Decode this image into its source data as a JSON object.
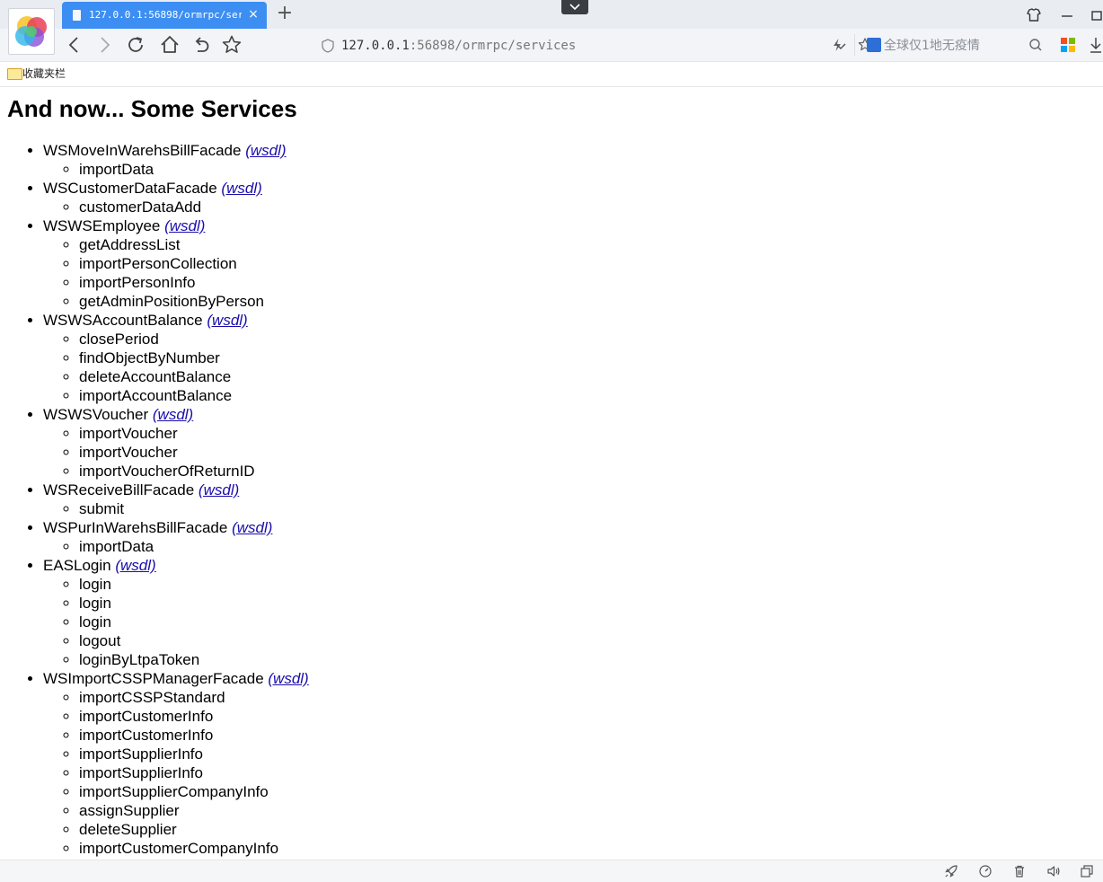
{
  "browser": {
    "tab_title": "127.0.0.1:56898/ormrpc/serv...",
    "tab_close": "×",
    "new_tab": "+",
    "url_host": "127.0.0.1",
    "url_rest": ":56898/ormrpc/services",
    "search_placeholder": "全球仅1地无疫情",
    "bookmarks_label": "收藏夹栏",
    "accent_color": "#3d8ef2"
  },
  "page": {
    "heading": "And now... Some Services",
    "wsdl_label": "(wsdl)",
    "services": [
      {
        "name": "WSMoveInWarehsBillFacade",
        "ops": [
          "importData"
        ]
      },
      {
        "name": "WSCustomerDataFacade",
        "ops": [
          "customerDataAdd"
        ]
      },
      {
        "name": "WSWSEmployee",
        "ops": [
          "getAddressList",
          "importPersonCollection",
          "importPersonInfo",
          "getAdminPositionByPerson"
        ]
      },
      {
        "name": "WSWSAccountBalance",
        "ops": [
          "closePeriod",
          "findObjectByNumber",
          "deleteAccountBalance",
          "importAccountBalance"
        ]
      },
      {
        "name": "WSWSVoucher",
        "ops": [
          "importVoucher",
          "importVoucher",
          "importVoucherOfReturnID"
        ]
      },
      {
        "name": "WSReceiveBillFacade",
        "ops": [
          "submit"
        ]
      },
      {
        "name": "WSPurInWarehsBillFacade",
        "ops": [
          "importData"
        ]
      },
      {
        "name": "EASLogin",
        "ops": [
          "login",
          "login",
          "login",
          "logout",
          "loginByLtpaToken"
        ]
      },
      {
        "name": "WSImportCSSPManagerFacade",
        "ops": [
          "importCSSPStandard",
          "importCustomerInfo",
          "importCustomerInfo",
          "importSupplierInfo",
          "importSupplierInfo",
          "importSupplierCompanyInfo",
          "assignSupplier",
          "deleteSupplier",
          "importCustomerCompanyInfo"
        ]
      }
    ]
  }
}
